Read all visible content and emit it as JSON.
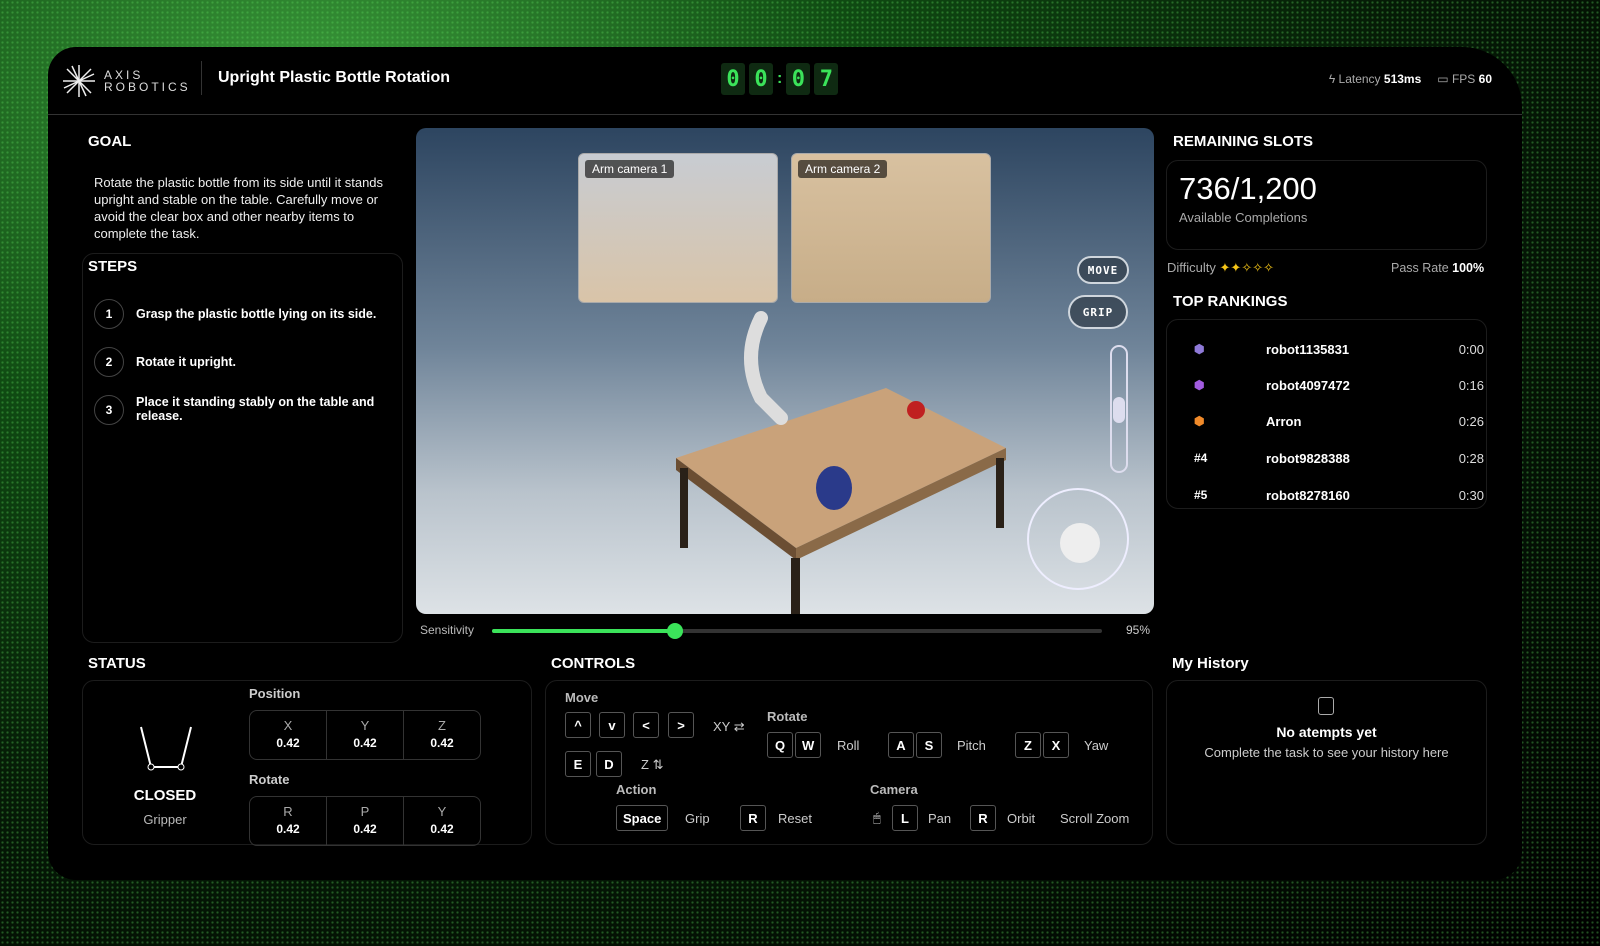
{
  "header": {
    "brand_line1": "AXIS",
    "brand_line2": "ROBOTICS",
    "title": "Upright Plastic Bottle Rotation",
    "timer": [
      "0",
      "0",
      "0",
      "7"
    ],
    "latency_label": "Latency",
    "latency_value": "513ms",
    "fps_label": "FPS",
    "fps_value": "60"
  },
  "goal": {
    "title": "GOAL",
    "text": "Rotate the plastic bottle from its side until it stands upright and stable on the table. Carefully move or avoid the clear box and other nearby items to complete the task."
  },
  "steps": {
    "title": "STEPS",
    "items": [
      {
        "n": "1",
        "text": "Grasp the plastic bottle lying on its side."
      },
      {
        "n": "2",
        "text": "Rotate it upright."
      },
      {
        "n": "3",
        "text": "Place it standing stably on the table and release."
      }
    ]
  },
  "viewport": {
    "cam1": "Arm camera 1",
    "cam2": "Arm camera 2",
    "move_btn": "MOVE",
    "grip_btn": "GRIP"
  },
  "sensitivity": {
    "label": "Sensitivity",
    "value": "95%",
    "fraction": 0.3
  },
  "slots": {
    "title": "REMAINING SLOTS",
    "value": "736/1,200",
    "caption": "Available Completions",
    "difficulty_label": "Difficulty",
    "difficulty_stars": 2,
    "difficulty_max": 5,
    "pass_label": "Pass Rate",
    "pass_value": "100%"
  },
  "rankings": {
    "title": "TOP RANKINGS",
    "rows": [
      {
        "rank": "",
        "badge": "purple-medal-icon",
        "name": "robot1135831",
        "time": "0:00"
      },
      {
        "rank": "",
        "badge": "violet-medal-icon",
        "name": "robot4097472",
        "time": "0:16"
      },
      {
        "rank": "",
        "badge": "orange-medal-icon",
        "name": "Arron",
        "time": "0:26"
      },
      {
        "rank": "#4",
        "name": "robot9828388",
        "time": "0:28"
      },
      {
        "rank": "#5",
        "name": "robot8278160",
        "time": "0:30"
      }
    ],
    "colors": {
      "purple": "#8f7ad8",
      "violet": "#a25ce0",
      "orange": "#f08a2a"
    }
  },
  "status": {
    "title": "STATUS",
    "gripper_state": "CLOSED",
    "gripper_label": "Gripper",
    "position_label": "Position",
    "rotate_label": "Rotate",
    "position": [
      {
        "k": "X",
        "v": "0.42"
      },
      {
        "k": "Y",
        "v": "0.42"
      },
      {
        "k": "Z",
        "v": "0.42"
      }
    ],
    "rotation": [
      {
        "k": "R",
        "v": "0.42"
      },
      {
        "k": "P",
        "v": "0.42"
      },
      {
        "k": "Y",
        "v": "0.42"
      }
    ]
  },
  "controls": {
    "title": "CONTROLS",
    "move_label": "Move",
    "arrows": [
      "^",
      "v",
      "<",
      ">"
    ],
    "xy_label": "XY",
    "ed": [
      "E",
      "D"
    ],
    "z_label": "Z",
    "rotate_label": "Rotate",
    "roll_keys": [
      "Q",
      "W"
    ],
    "roll": "Roll",
    "pitch_keys": [
      "A",
      "S"
    ],
    "pitch": "Pitch",
    "yaw_keys": [
      "Z",
      "X"
    ],
    "yaw": "Yaw",
    "action_label": "Action",
    "space_key": "Space",
    "grip": "Grip",
    "reset_key": "R",
    "reset": "Reset",
    "camera_label": "Camera",
    "pan_key": "L",
    "pan": "Pan",
    "orbit_key": "R",
    "orbit": "Orbit",
    "scroll_zoom": "Scroll Zoom"
  },
  "history": {
    "title": "My History",
    "empty_title": "No atempts yet",
    "empty_text": "Complete the task to see your history here"
  },
  "colors": {
    "accent": "#3be35a",
    "star": "#f5c518"
  }
}
